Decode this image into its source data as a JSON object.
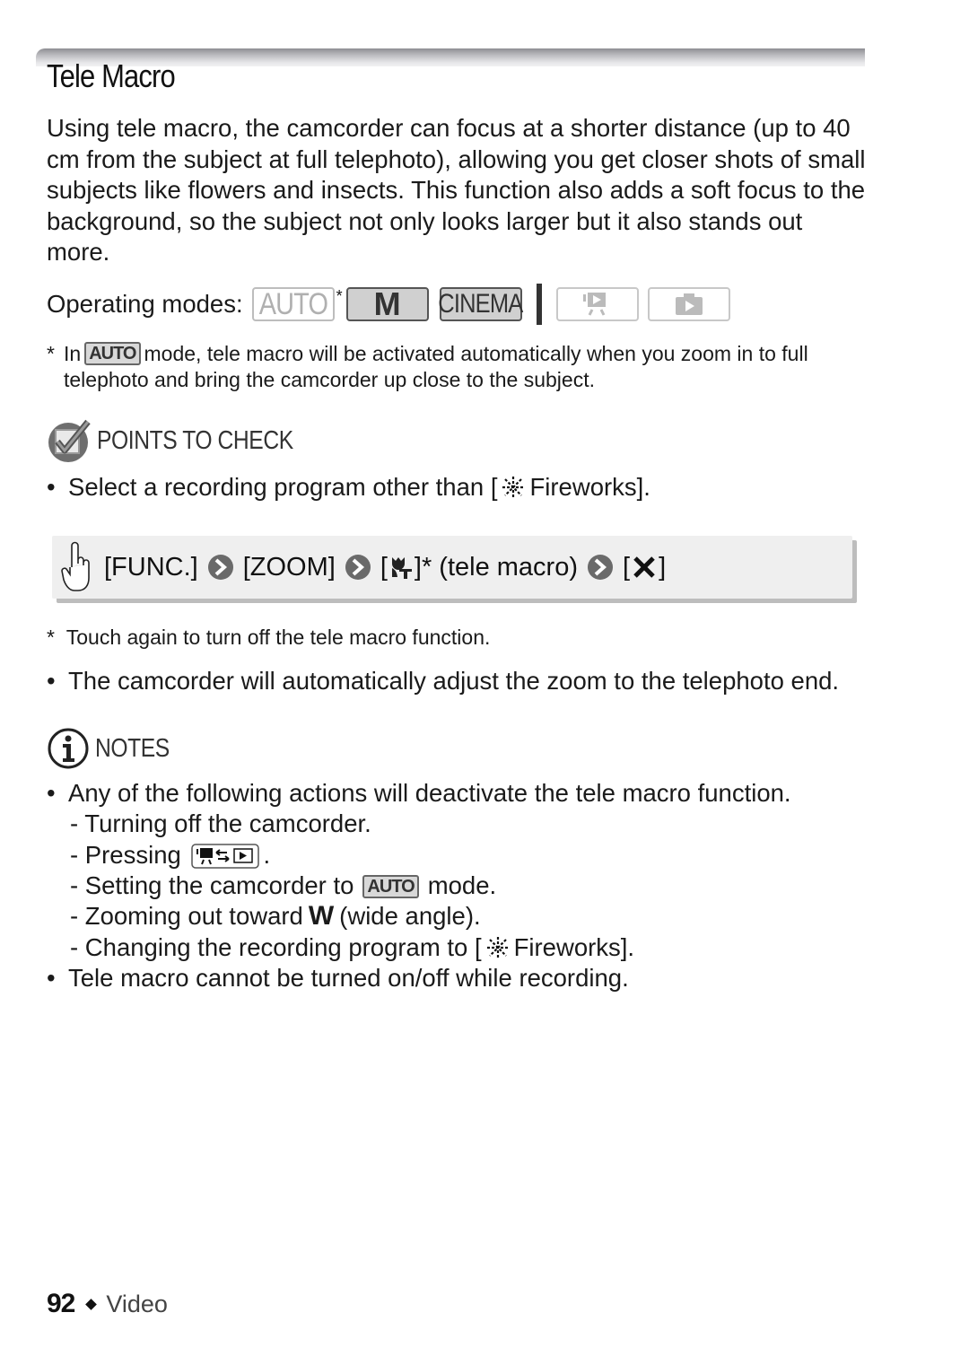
{
  "header": {
    "title": "Tele Macro"
  },
  "intro": "Using tele macro, the camcorder can focus at a shorter distance (up to 40 cm from the subject at full telephoto), allowing you get closer shots of small subjects like flowers and insects. This function also adds a soft focus to the background, so the subject not only looks larger but it also stands out more.",
  "operating_modes": {
    "label": "Operating modes:",
    "modes": [
      {
        "name": "AUTO",
        "active": false,
        "asterisk": "*"
      },
      {
        "name": "M",
        "active": true
      },
      {
        "name": "CINEMA",
        "active": true
      },
      {
        "name": "video-playback-icon",
        "active": false
      },
      {
        "name": "photo-playback-icon",
        "active": false
      }
    ]
  },
  "footnote_auto": {
    "marker": "*",
    "before": "In",
    "badge": "AUTO",
    "after": "mode, tele macro will be activated automatically when you zoom in to full telephoto and bring the camcorder up close to the subject."
  },
  "points_to_check": {
    "heading": "POINTS TO CHECK",
    "items": [
      {
        "before": "Select a recording program other than [",
        "icon": "fireworks-icon",
        "after": "Fireworks]."
      }
    ]
  },
  "procedure": {
    "steps": [
      "[FUNC.]",
      "[ZOOM]",
      "]* (tele macro)",
      "[",
      "]"
    ],
    "step1": "[FUNC.]",
    "step2": "[ZOOM]",
    "step3_open": "[",
    "step3_close": "]* (tele macro)",
    "step4_open": "[",
    "step4_close": "]"
  },
  "footnote_touch": {
    "marker": "*",
    "text": "Touch again to turn off the tele macro function."
  },
  "zoom_note": "The camcorder will automatically adjust the zoom to the telephoto end.",
  "notes": {
    "heading": "NOTES",
    "main": "Any of the following actions will deactivate the tele macro function.",
    "sub": {
      "s1": "- Turning off the camcorder.",
      "s2_before": "- Pressing",
      "s2_after": ".",
      "s3_before": "- Setting the camcorder to",
      "s3_badge": "AUTO",
      "s3_after": "mode.",
      "s4_before": "- Zooming out toward",
      "s4_glyph": "W",
      "s4_after": "(wide angle).",
      "s5_before": "- Changing the recording program to [",
      "s5_after": "Fireworks]."
    },
    "last": "Tele macro cannot be turned on/off while recording."
  },
  "footer": {
    "page_number": "92",
    "section": "Video"
  },
  "bullet_glyph": "•"
}
